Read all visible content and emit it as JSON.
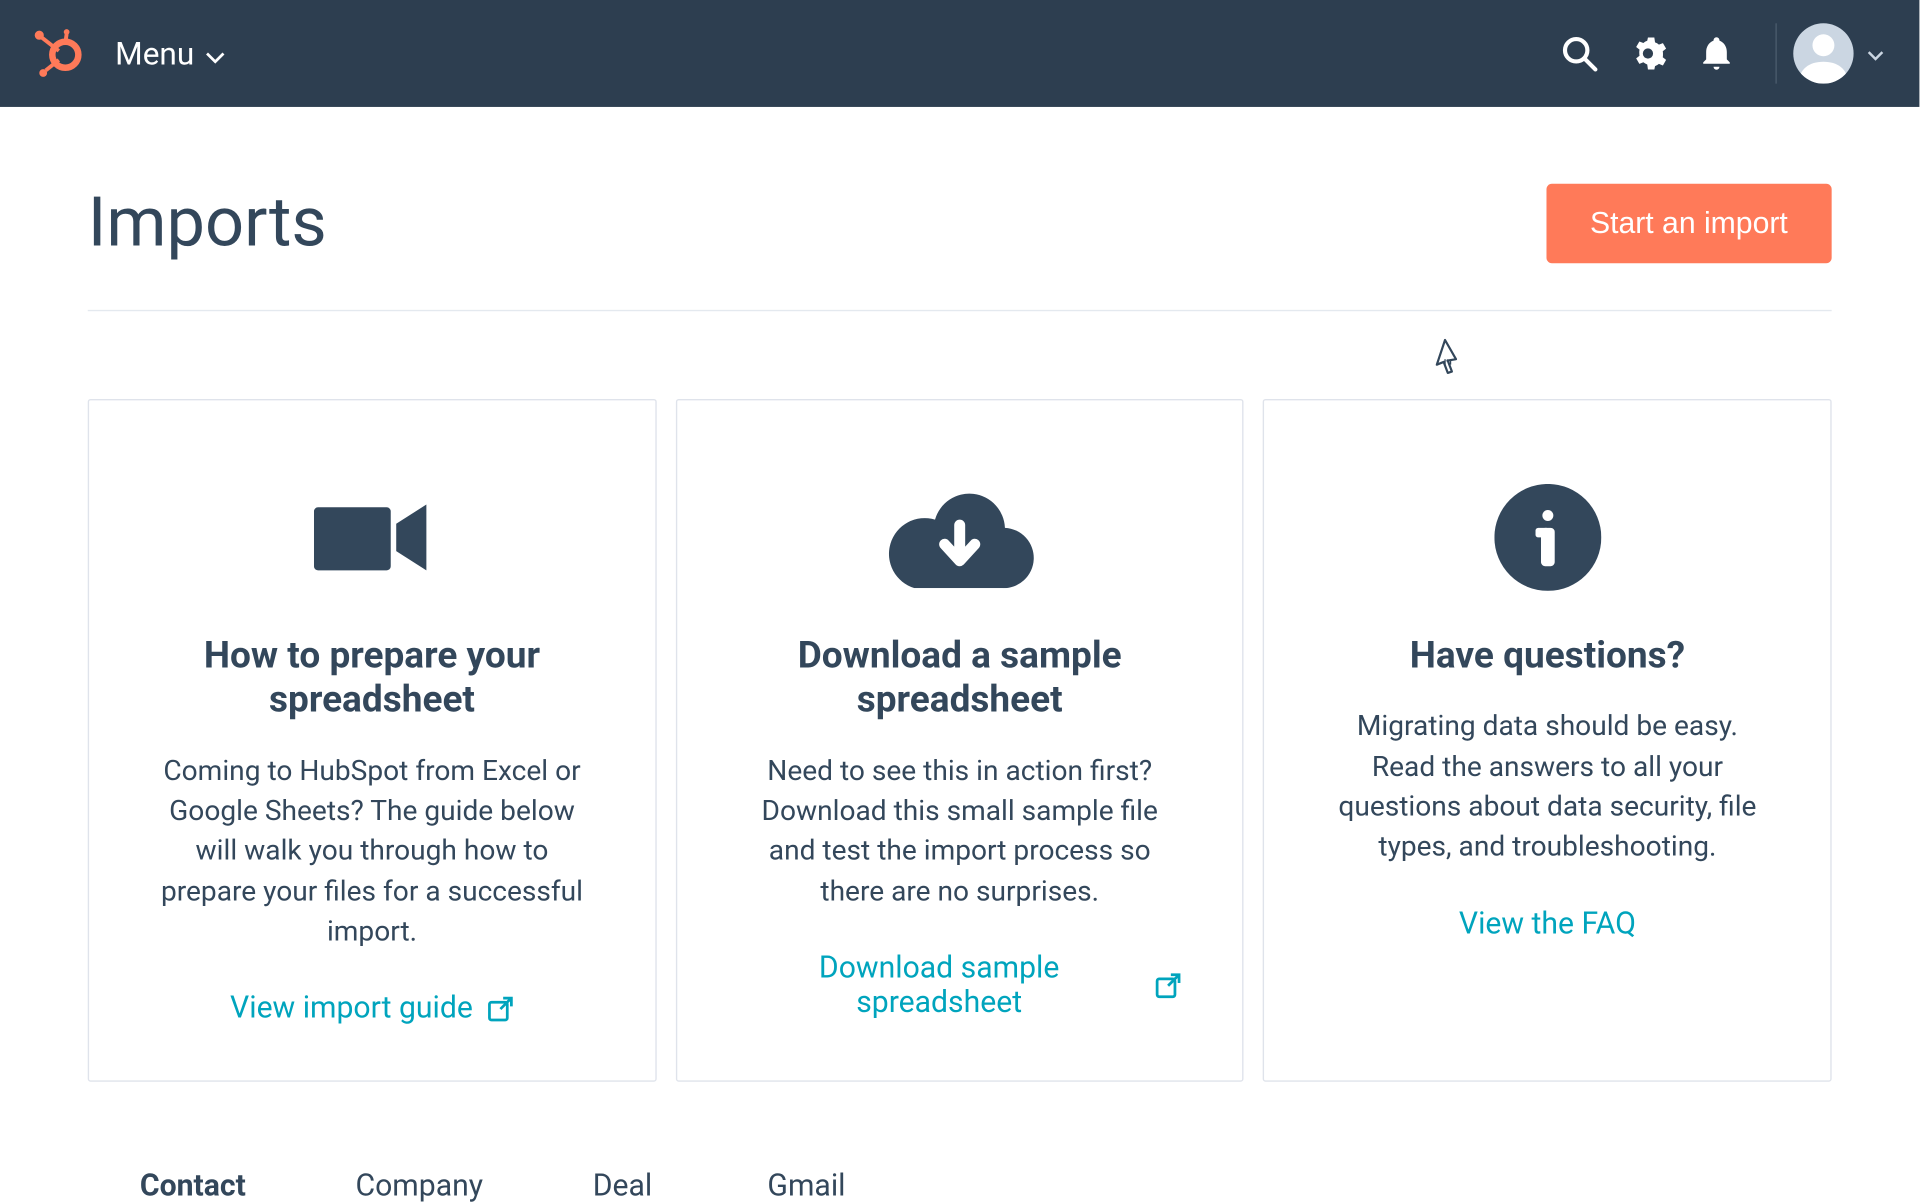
{
  "header": {
    "menu_label": "Menu"
  },
  "page": {
    "title": "Imports",
    "primary_button": "Start an import"
  },
  "cards": [
    {
      "title": "How to prepare your spreadsheet",
      "description": "Coming to HubSpot from Excel or Google Sheets? The guide below will walk you through how to prepare your files for a successful import.",
      "link_label": "View import guide"
    },
    {
      "title": "Download a sample spreadsheet",
      "description": "Need to see this in action first? Download this small sample file and test the import process so there are no surprises.",
      "link_label": "Download sample spreadsheet"
    },
    {
      "title": "Have questions?",
      "description": "Migrating data should be easy. Read the answers to all your questions about data security, file types, and troubleshooting.",
      "link_label": "View the FAQ"
    }
  ],
  "tabs": [
    "Contact",
    "Company",
    "Deal",
    "Gmail"
  ],
  "colors": {
    "brand_orange": "#ff7a59",
    "navy": "#2d3e50",
    "text": "#33475b",
    "link": "#00a4bd"
  }
}
